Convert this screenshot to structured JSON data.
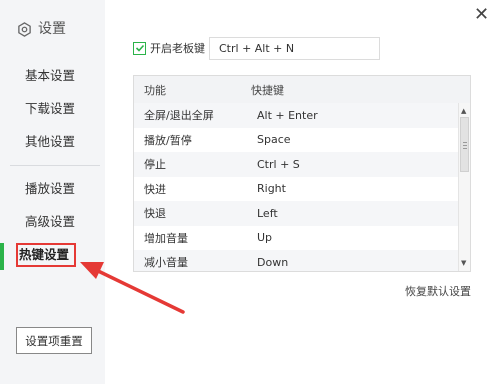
{
  "sidebar": {
    "title": "设置",
    "items": [
      {
        "label": "基本设置"
      },
      {
        "label": "下载设置"
      },
      {
        "label": "其他设置"
      },
      {
        "label": "播放设置"
      },
      {
        "label": "高级设置"
      },
      {
        "label": "热键设置"
      }
    ],
    "reset_button": "设置项重置"
  },
  "boss_key": {
    "checked": true,
    "label": "开启老板键",
    "value": "Ctrl + Alt + N"
  },
  "hotkey_table": {
    "headers": {
      "function": "功能",
      "shortcut": "快捷键"
    },
    "rows": [
      {
        "function": "全屏/退出全屏",
        "shortcut": "Alt + Enter"
      },
      {
        "function": "播放/暂停",
        "shortcut": "Space"
      },
      {
        "function": "停止",
        "shortcut": "Ctrl + S"
      },
      {
        "function": "快进",
        "shortcut": "Right"
      },
      {
        "function": "快退",
        "shortcut": "Left"
      },
      {
        "function": "增加音量",
        "shortcut": "Up"
      },
      {
        "function": "减小音量",
        "shortcut": "Down"
      }
    ]
  },
  "restore_default": "恢复默认设置",
  "colors": {
    "accent_green": "#2bb349",
    "annotation_red": "#e53935"
  },
  "icons": {
    "sidebar_header": "gear-icon",
    "close": "close-icon",
    "checkbox": "checkmark-icon",
    "scroll_up": "triangle-up-icon",
    "scroll_down": "triangle-down-icon",
    "annotation": "red-arrow-icon"
  }
}
